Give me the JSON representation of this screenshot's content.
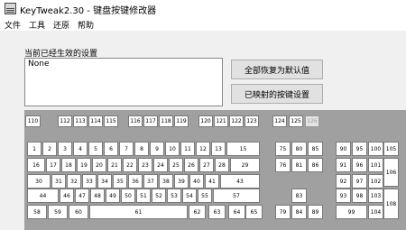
{
  "window": {
    "title": "KeyTweak2.30 - 键盘按键修改器",
    "icon": "keyboard-app-icon"
  },
  "menu": [
    "文件",
    "工具",
    "还原",
    "帮助"
  ],
  "settings": {
    "label": "当前已经生效的设置",
    "value": "None"
  },
  "buttons": {
    "restore_defaults": "全部恢复为默认值",
    "mapped_keys": "已映射的按键设置"
  },
  "keyboard": {
    "keys": [
      {
        "label": "110"
      },
      {
        "label": "112"
      },
      {
        "label": "113"
      },
      {
        "label": "114"
      },
      {
        "label": "115"
      },
      {
        "label": "116"
      },
      {
        "label": "117"
      },
      {
        "label": "118"
      },
      {
        "label": "119"
      },
      {
        "label": "120"
      },
      {
        "label": "121"
      },
      {
        "label": "122"
      },
      {
        "label": "123"
      },
      {
        "label": "124"
      },
      {
        "label": "125"
      },
      {
        "label": "126",
        "disabled": true
      },
      {
        "label": "1"
      },
      {
        "label": "2"
      },
      {
        "label": "3"
      },
      {
        "label": "4"
      },
      {
        "label": "5"
      },
      {
        "label": "6"
      },
      {
        "label": "7"
      },
      {
        "label": "8"
      },
      {
        "label": "9"
      },
      {
        "label": "10"
      },
      {
        "label": "11"
      },
      {
        "label": "12"
      },
      {
        "label": "13"
      },
      {
        "label": "15"
      },
      {
        "label": "16"
      },
      {
        "label": "17"
      },
      {
        "label": "18"
      },
      {
        "label": "19"
      },
      {
        "label": "20"
      },
      {
        "label": "21"
      },
      {
        "label": "22"
      },
      {
        "label": "23"
      },
      {
        "label": "24"
      },
      {
        "label": "25"
      },
      {
        "label": "26"
      },
      {
        "label": "27"
      },
      {
        "label": "28"
      },
      {
        "label": "29"
      },
      {
        "label": "30"
      },
      {
        "label": "31"
      },
      {
        "label": "32"
      },
      {
        "label": "33"
      },
      {
        "label": "34"
      },
      {
        "label": "35"
      },
      {
        "label": "36"
      },
      {
        "label": "37"
      },
      {
        "label": "38"
      },
      {
        "label": "39"
      },
      {
        "label": "40"
      },
      {
        "label": "41"
      },
      {
        "label": "43"
      },
      {
        "label": "44"
      },
      {
        "label": "46"
      },
      {
        "label": "47"
      },
      {
        "label": "48"
      },
      {
        "label": "49"
      },
      {
        "label": "50"
      },
      {
        "label": "51"
      },
      {
        "label": "52"
      },
      {
        "label": "53"
      },
      {
        "label": "54"
      },
      {
        "label": "55"
      },
      {
        "label": "57"
      },
      {
        "label": "58"
      },
      {
        "label": "59"
      },
      {
        "label": "60"
      },
      {
        "label": "61"
      },
      {
        "label": "62"
      },
      {
        "label": "63"
      },
      {
        "label": "64"
      },
      {
        "label": "65"
      },
      {
        "label": "75"
      },
      {
        "label": "80"
      },
      {
        "label": "85"
      },
      {
        "label": "76"
      },
      {
        "label": "81"
      },
      {
        "label": "86"
      },
      {
        "label": "83"
      },
      {
        "label": "79"
      },
      {
        "label": "84"
      },
      {
        "label": "89"
      },
      {
        "label": "90"
      },
      {
        "label": "95"
      },
      {
        "label": "100"
      },
      {
        "label": "105"
      },
      {
        "label": "91"
      },
      {
        "label": "96"
      },
      {
        "label": "101"
      },
      {
        "label": "106"
      },
      {
        "label": "92"
      },
      {
        "label": "97"
      },
      {
        "label": "102"
      },
      {
        "label": "93"
      },
      {
        "label": "98"
      },
      {
        "label": "103"
      },
      {
        "label": "108"
      },
      {
        "label": "99"
      },
      {
        "label": "104"
      }
    ]
  }
}
